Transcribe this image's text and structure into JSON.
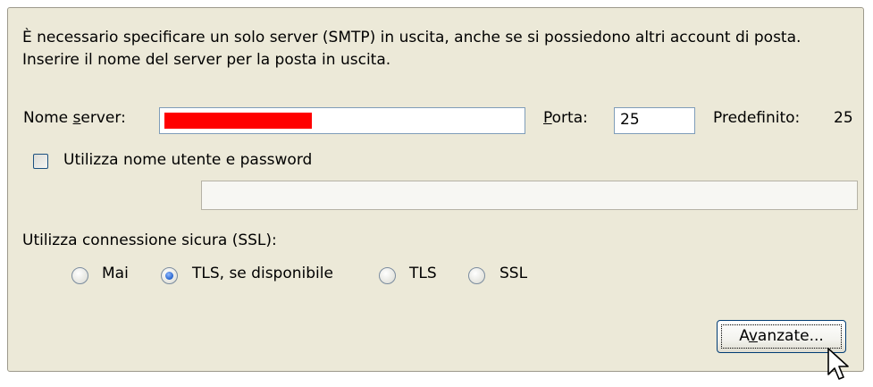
{
  "description": "È necessario specificare un solo server (SMTP) in uscita, anche se si possiedono altri account di posta. Inserire il nome del server per la posta in uscita.",
  "server": {
    "label_pre": "Nome ",
    "label_accel": "s",
    "label_post": "erver:",
    "value": ""
  },
  "port": {
    "label_accel": "P",
    "label_post": "orta:",
    "value": "25",
    "default_label": "Predefinito:",
    "default_value": "25"
  },
  "auth": {
    "checkbox_label": "Utilizza nome utente e password",
    "checked": false,
    "username_value": ""
  },
  "ssl": {
    "label": "Utilizza connessione sicura (SSL):",
    "options": [
      {
        "label": "Mai",
        "checked": false
      },
      {
        "label": "TLS, se disponibile",
        "checked": true
      },
      {
        "label": "TLS",
        "checked": false
      },
      {
        "label": "SSL",
        "checked": false
      }
    ]
  },
  "advanced_button": {
    "label_pre": "A",
    "label_accel": "v",
    "label_post": "anzate..."
  }
}
